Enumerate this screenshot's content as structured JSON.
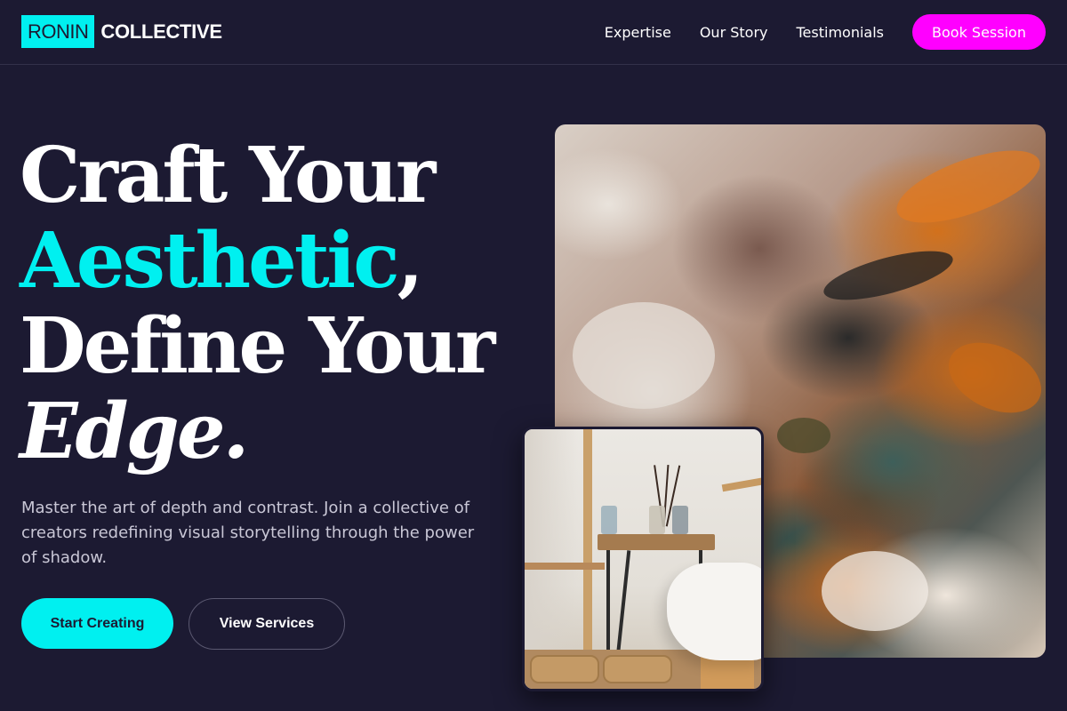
{
  "nav": {
    "logo_box": "RONIN",
    "logo_text": "COLLECTIVE",
    "links": [
      "Expertise",
      "Our Story",
      "Testimonials"
    ],
    "cta": "Book Session"
  },
  "hero": {
    "headline": {
      "line1": "Craft Your",
      "accent": "Aesthetic",
      "comma": ",",
      "line3": "Define Your",
      "line4": "Edge."
    },
    "subtext": "Master the art of depth and contrast. Join a collective of creators redefining visual storytelling through the power of shadow.",
    "primary_button": "Start Creating",
    "secondary_button": "View Services"
  },
  "colors": {
    "background": "#1c1a32",
    "accent_cyan": "#00f0f0",
    "accent_magenta": "#ff00ff"
  }
}
